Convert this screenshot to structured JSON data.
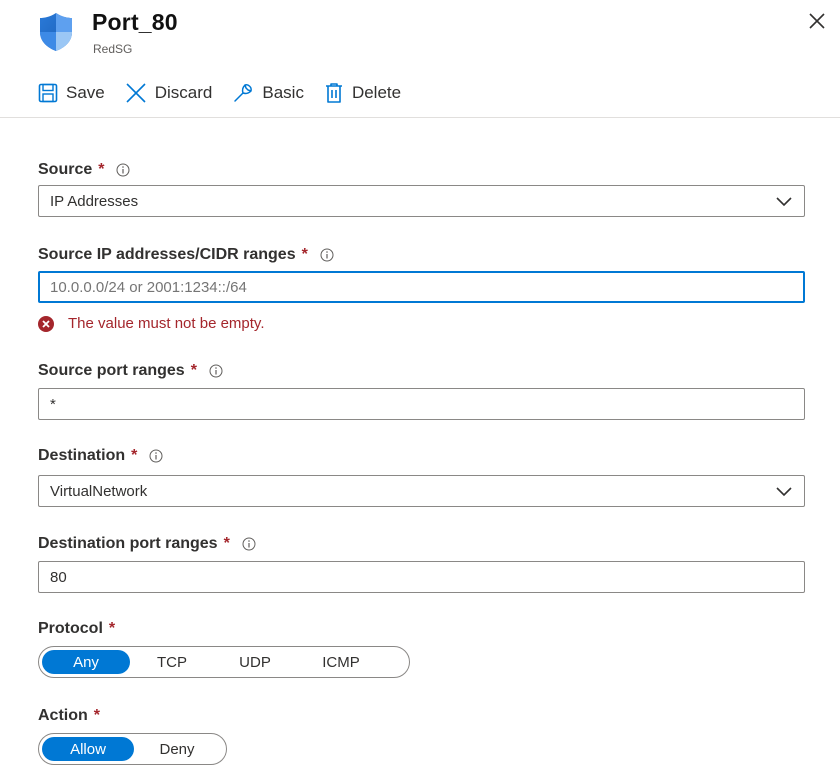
{
  "header": {
    "title": "Port_80",
    "subtitle": "RedSG"
  },
  "toolbar": {
    "save": "Save",
    "discard": "Discard",
    "basic": "Basic",
    "delete": "Delete"
  },
  "form": {
    "source": {
      "label": "Source",
      "required": "*",
      "value": "IP Addresses"
    },
    "source_ip": {
      "label": "Source IP addresses/CIDR ranges",
      "required": "*",
      "placeholder": "10.0.0.0/24 or 2001:1234::/64",
      "value": "",
      "error": "The value must not be empty."
    },
    "source_ports": {
      "label": "Source port ranges",
      "required": "*",
      "value": "*"
    },
    "destination": {
      "label": "Destination",
      "required": "*",
      "value": "VirtualNetwork"
    },
    "destination_ports": {
      "label": "Destination port ranges",
      "required": "*",
      "value": "80"
    },
    "protocol": {
      "label": "Protocol",
      "required": "*",
      "options": [
        "Any",
        "TCP",
        "UDP",
        "ICMP"
      ],
      "selected": "Any"
    },
    "action": {
      "label": "Action",
      "required": "*",
      "options": [
        "Allow",
        "Deny"
      ],
      "selected": "Allow"
    }
  },
  "colors": {
    "accent": "#0078d4",
    "error": "#a4262c",
    "border": "#8a8886",
    "text": "#323130"
  },
  "icons": {
    "header": "shield-icon",
    "close": "close-icon",
    "save": "save-icon",
    "discard": "discard-icon",
    "basic": "wrench-icon",
    "delete": "trash-icon",
    "info": "info-icon",
    "error": "error-icon",
    "dropdown": "chevron-down-icon"
  }
}
